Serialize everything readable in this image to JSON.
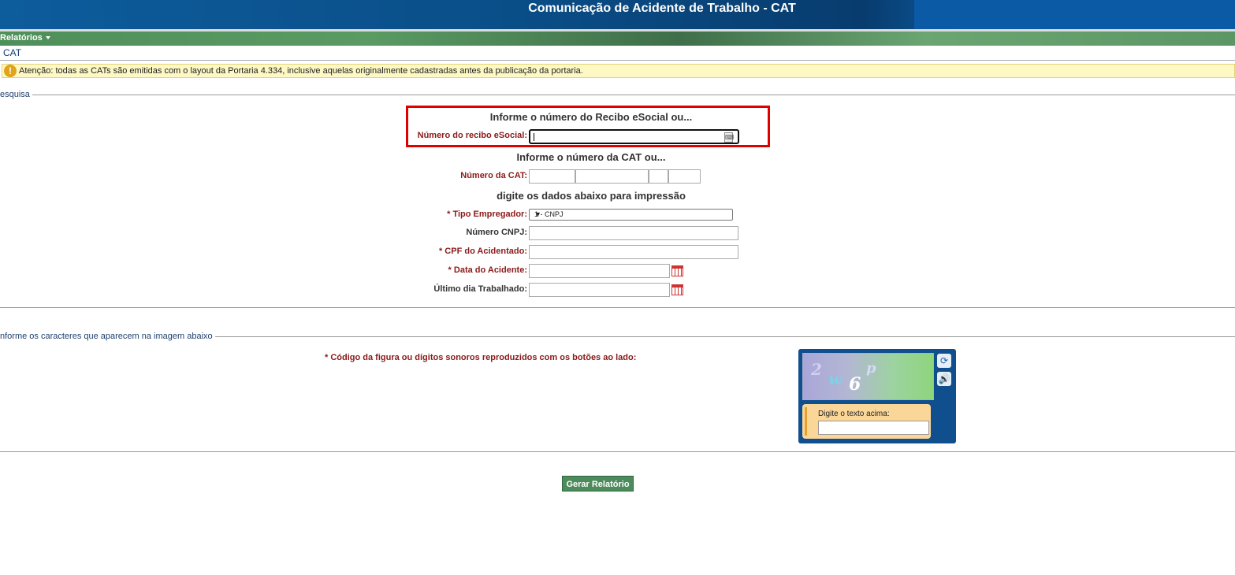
{
  "header": {
    "title": "Comunicação de Acidente de Trabalho - CAT"
  },
  "menu": {
    "reports_label": "Relatórios"
  },
  "breadcrumb": "CAT",
  "warning": {
    "icon": "exclamation-icon",
    "text": "Atenção: todas as CATs são emitidas com o layout da Portaria 4.334, inclusive aquelas originalmente cadastradas antes da publicação da portaria."
  },
  "pesquisa": {
    "legend": "esquisa",
    "recibo_title": "Informe o número do Recibo eSocial ou...",
    "recibo_label": "Número do recibo eSocial:",
    "recibo_value": "",
    "cat_title": "Informe o número da CAT ou...",
    "cat_label": "Número da CAT:",
    "dados_title": "digite os dados abaixo para impressão",
    "tipo_label": "* Tipo Empregador:",
    "tipo_selected": "1 - CNPJ",
    "cnpj_label": "Número CNPJ:",
    "cpf_label": "* CPF do Acidentado:",
    "data_label": "* Data do Acidente:",
    "ultimo_label": "Último dia Trabalhado:"
  },
  "captcha": {
    "legend": "nforme os caracteres que aparecem na imagem abaixo",
    "instruction": "* Código da figura ou dígitos sonoros reproduzidos com os botões ao lado:",
    "chars": [
      "2",
      "w",
      "6",
      "p"
    ],
    "input_label": "Digite o texto acima:",
    "refresh_icon": "refresh-icon",
    "audio_icon": "speaker-icon"
  },
  "submit_label": "Gerar Relatório",
  "colors": {
    "header_blue": "#0b5aa6",
    "menu_green": "#5a9a63",
    "label_red": "#8b1a1a",
    "highlight_red": "#e00000"
  }
}
